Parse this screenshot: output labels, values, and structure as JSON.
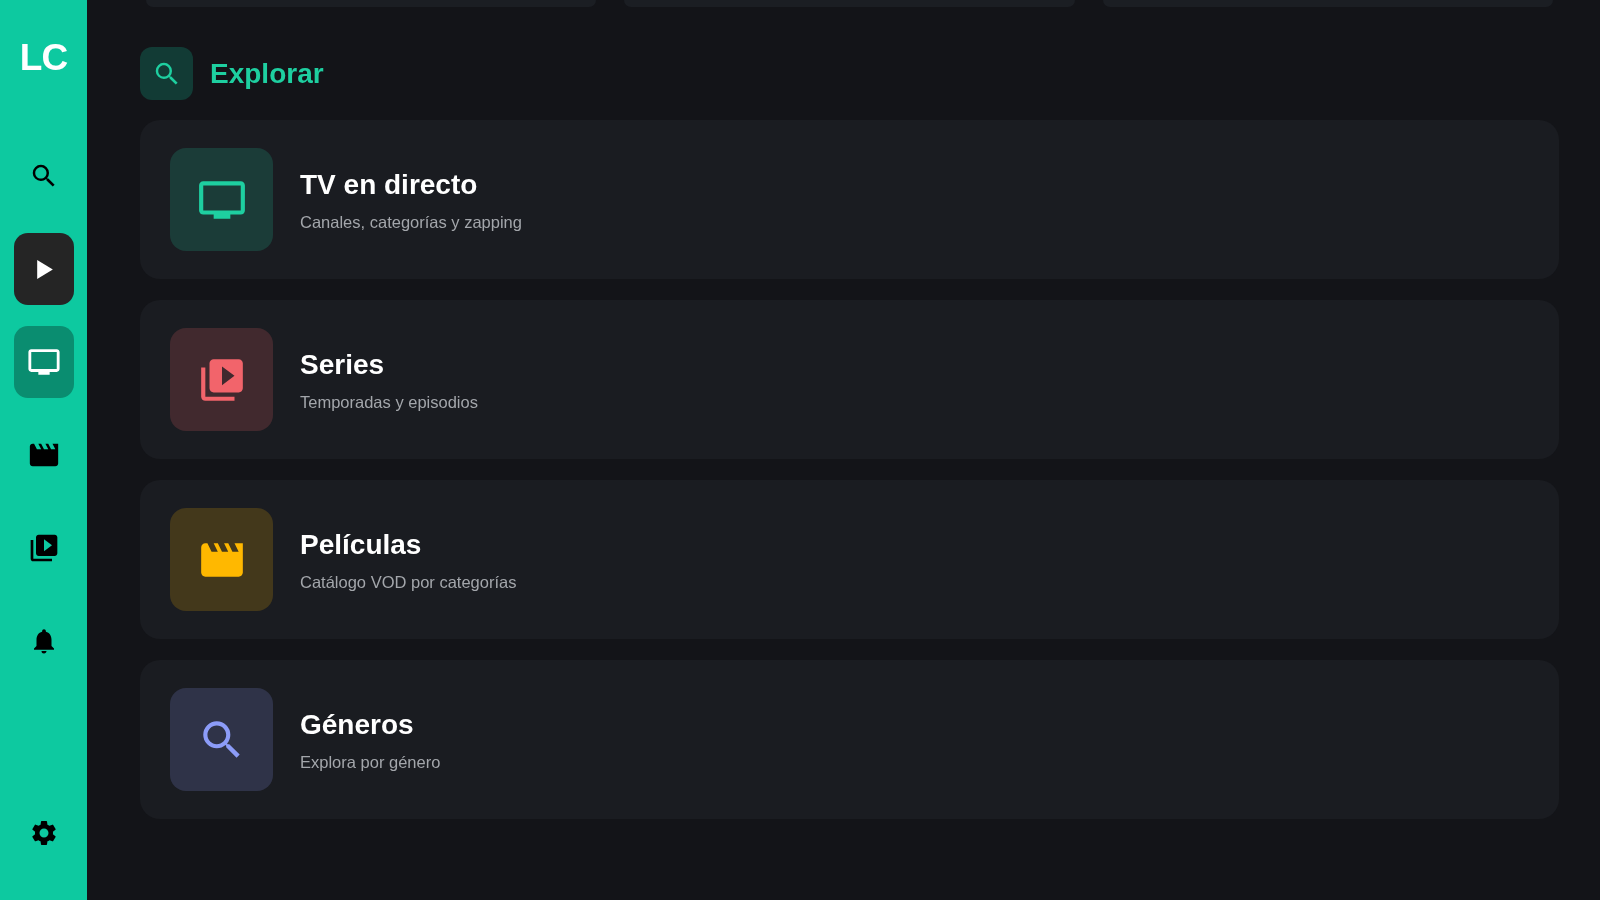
{
  "sidebar": {
    "logo": "LC",
    "items": [
      {
        "kind": "search",
        "selected": false,
        "focused": false
      },
      {
        "kind": "play",
        "selected": false,
        "focused": true
      },
      {
        "kind": "tv",
        "selected": true,
        "focused": false
      },
      {
        "kind": "movies",
        "selected": false,
        "focused": false
      },
      {
        "kind": "series",
        "selected": false,
        "focused": false
      },
      {
        "kind": "notifications",
        "selected": false,
        "focused": false
      }
    ],
    "footer_items": [
      {
        "kind": "settings",
        "selected": false,
        "focused": false
      }
    ]
  },
  "header": {
    "title": "Explorar"
  },
  "cards": [
    {
      "kind": "tv",
      "title": "TV en directo",
      "subtitle": "Canales, categorías y zapping",
      "color": "#1ecfa0"
    },
    {
      "kind": "series",
      "title": "Series",
      "subtitle": "Temporadas y episodios",
      "color": "#f2646b"
    },
    {
      "kind": "movies",
      "title": "Películas",
      "subtitle": "Catálogo VOD por categorías",
      "color": "#ffb800"
    },
    {
      "kind": "genres",
      "title": "Géneros",
      "subtitle": "Explora por género",
      "color": "#8c9cf8"
    }
  ]
}
